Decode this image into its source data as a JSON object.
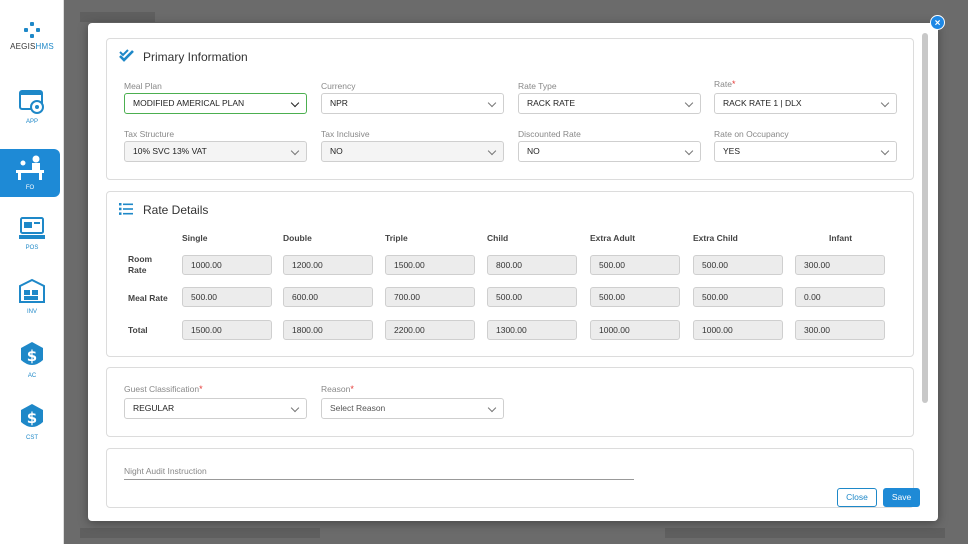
{
  "app": {
    "brand_prefix": "AEGIS",
    "brand_suffix": "HMS"
  },
  "sidebar": {
    "items": [
      {
        "label": "APP",
        "icon": "app-settings-icon"
      },
      {
        "label": "FO",
        "icon": "front-office-icon",
        "active": true
      },
      {
        "label": "POS",
        "icon": "pos-icon"
      },
      {
        "label": "INV",
        "icon": "inventory-icon"
      },
      {
        "label": "AC",
        "icon": "accounts-dollar-icon"
      },
      {
        "label": "CST",
        "icon": "cost-dollar-icon"
      }
    ]
  },
  "primary": {
    "title": "Primary Information",
    "fields": {
      "meal_plan": {
        "label": "Meal Plan",
        "value": "MODIFIED AMERICAL PLAN"
      },
      "currency": {
        "label": "Currency",
        "value": "NPR"
      },
      "rate_type": {
        "label": "Rate Type",
        "value": "RACK RATE"
      },
      "rate": {
        "label": "Rate",
        "value": "RACK RATE 1 | DLX"
      },
      "tax_structure": {
        "label": "Tax Structure",
        "value": "10% SVC 13% VAT"
      },
      "tax_inclusive": {
        "label": "Tax Inclusive",
        "value": "NO"
      },
      "discounted_rate": {
        "label": "Discounted Rate",
        "value": "NO"
      },
      "rate_on_occupancy": {
        "label": "Rate on Occupancy",
        "value": "YES"
      }
    },
    "required_mark": "*"
  },
  "rate_details": {
    "title": "Rate Details",
    "columns": [
      "Single",
      "Double",
      "Triple",
      "Child",
      "Extra Adult",
      "Extra Child",
      "Infant"
    ],
    "rows": [
      {
        "label_line1": "Room",
        "label_line2": "Rate",
        "values": [
          "1000.00",
          "1200.00",
          "1500.00",
          "800.00",
          "500.00",
          "500.00",
          "300.00"
        ]
      },
      {
        "label_line1": "Meal Rate",
        "label_line2": "",
        "values": [
          "500.00",
          "600.00",
          "700.00",
          "500.00",
          "500.00",
          "500.00",
          "0.00"
        ]
      },
      {
        "label_line1": "Total",
        "label_line2": "",
        "values": [
          "1500.00",
          "1800.00",
          "2200.00",
          "1300.00",
          "1000.00",
          "1000.00",
          "300.00"
        ]
      }
    ]
  },
  "guest": {
    "classification_label": "Guest Classification",
    "classification_value": "REGULAR",
    "reason_label": "Reason",
    "reason_placeholder": "Select Reason"
  },
  "night_audit": {
    "label": "Night Audit Instruction"
  },
  "buttons": {
    "close": "Close",
    "save": "Save"
  },
  "colors": {
    "accent": "#1e8ad6",
    "focus": "#4caf50",
    "required": "#e53935"
  }
}
